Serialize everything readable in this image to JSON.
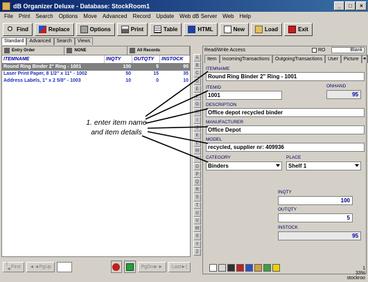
{
  "window": {
    "title": "dB Organizer Deluxe - Database: StockRoom1",
    "controls": [
      "_",
      "□",
      "×"
    ]
  },
  "menu": [
    "File",
    "Print",
    "Search",
    "Options",
    "Move",
    "Advanced",
    "Record",
    "Update",
    "Web dB Server",
    "Web",
    "Help"
  ],
  "toolbar": {
    "find": "Find",
    "replace": "Replace",
    "options": "Options",
    "print": "Print",
    "table": "Table",
    "html": "HTML",
    "new": "New",
    "load": "Load",
    "exit": "Exit"
  },
  "view_tabs": [
    "Standard",
    "Advanced",
    "Search",
    "Views"
  ],
  "grid_toolbar": [
    "Entry Order",
    "NONE",
    "All Records"
  ],
  "grid": {
    "headers": [
      "ITEMNAME",
      "INQTY",
      "OUTQTY",
      "INSTOCK"
    ],
    "rows": [
      {
        "name": "Round Ring Binder 2\" Ring - 1001",
        "inqty": "100",
        "outqty": "5",
        "instock": "95",
        "selected": true
      },
      {
        "name": "Laser Print Paper, 8 1/2\" x 11\" - 1002",
        "inqty": "50",
        "outqty": "15",
        "instock": "35",
        "selected": false
      },
      {
        "name": "Address Labels, 1\" x 2 5/8\" - 1003",
        "inqty": "10",
        "outqty": "0",
        "instock": "10",
        "selected": false
      }
    ]
  },
  "letters": [
    "A",
    "B",
    "C",
    "D",
    "E",
    "F",
    "G",
    "H",
    "I",
    "J",
    "K",
    "L",
    "M",
    "N",
    "O",
    "P",
    "Q",
    "R",
    "S",
    "T",
    "U",
    "V",
    "W",
    "X",
    "Y",
    "Z"
  ],
  "left_nav": {
    "first": "First",
    "pgup": "PgUp",
    "pgdn": "PgDn",
    "last": "Last"
  },
  "right": {
    "access": "Read/Write Access",
    "ro": "RO",
    "blank": "Blank",
    "tabs": [
      "Item",
      "IncomingTransactions",
      "OutgoingTransactions",
      "User",
      "Picture"
    ],
    "fields": {
      "itemname": {
        "label": "ITEMNAME",
        "value": "Round Ring Binder 2\" Ring - 1001"
      },
      "itemid": {
        "label": "ITEMID",
        "value": "1001"
      },
      "onhand": {
        "label": "ONHAND",
        "value": "95"
      },
      "description": {
        "label": "DESCRIPTION",
        "value": "Office depot recycled binder"
      },
      "manufacturer": {
        "label": "MANUFACTURER",
        "value": "Office Depot"
      },
      "model": {
        "label": "MODEL",
        "value": "recycled, supplier nr: 409936"
      },
      "category": {
        "label": "CATEGORY",
        "value": "Binders"
      },
      "place": {
        "label": "PLACE",
        "value": "Shelf 1"
      },
      "inqty": {
        "label": "INQTY",
        "value": "100"
      },
      "outqty": {
        "label": "OUTQTY",
        "value": "5"
      },
      "instock": {
        "label": "INSTOCK",
        "value": "95"
      }
    },
    "dots": "..."
  },
  "status": {
    "record": "1",
    "pct": "33%",
    "name": "stockroo"
  },
  "annotation": {
    "line1": "1. enter item name",
    "line2": "and item details"
  }
}
